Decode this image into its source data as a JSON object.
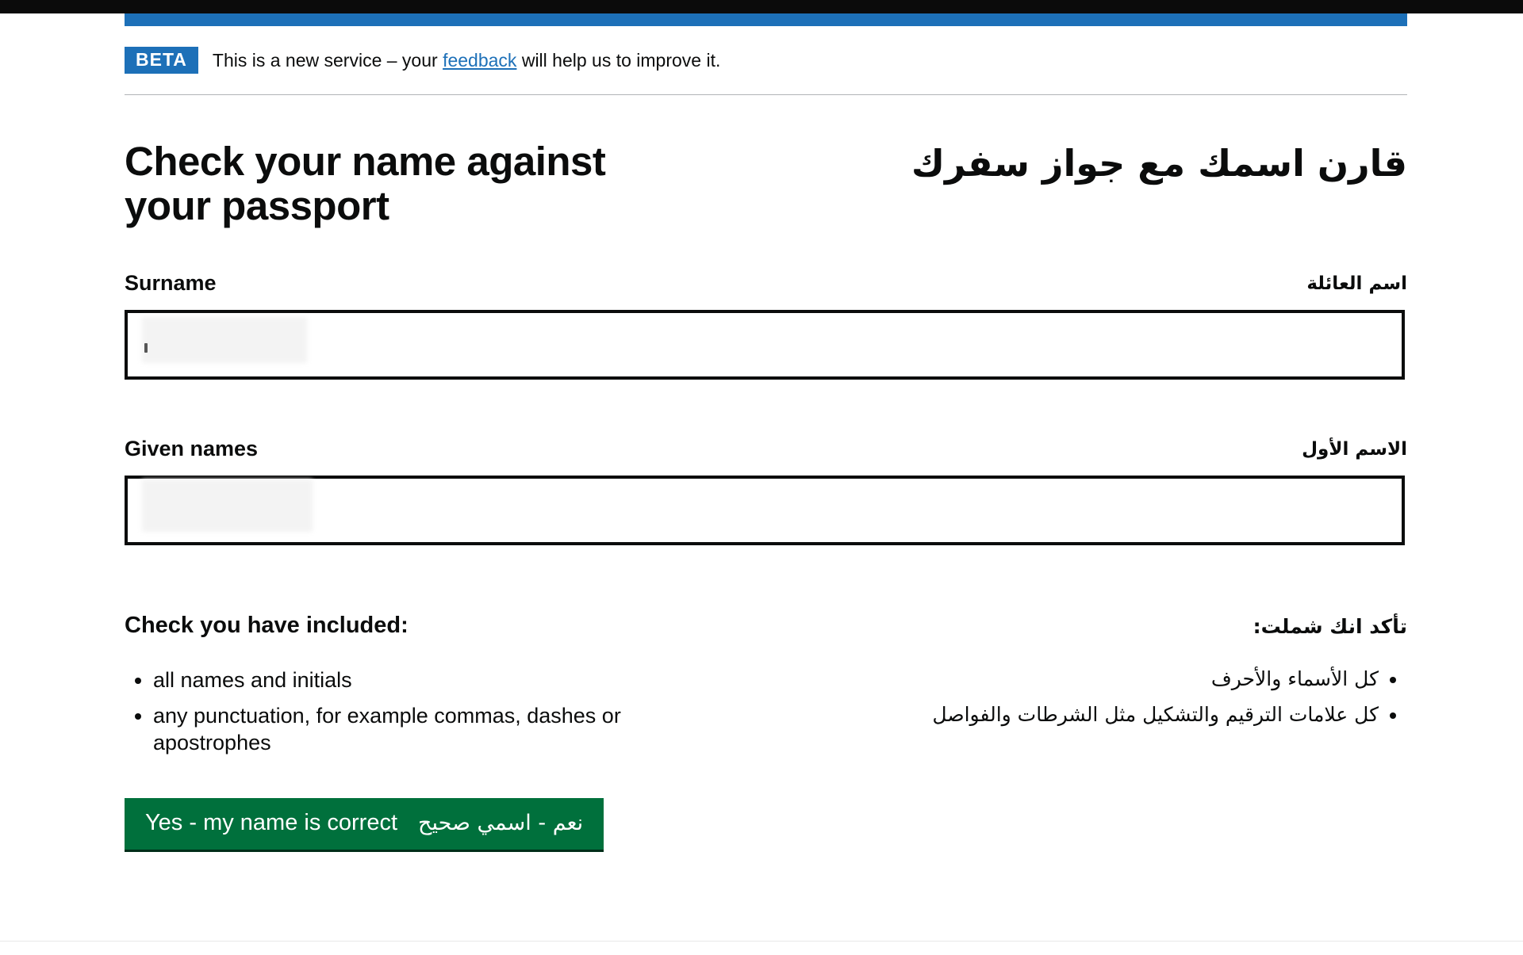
{
  "browser": {
    "chrome_bar_color": "#0b0b0b"
  },
  "brand": {
    "blue": "#1d70b8",
    "green": "#00703c",
    "text": "#0b0c0c"
  },
  "phase_banner": {
    "tag": "BETA",
    "text_before_link": "This is a new service – your ",
    "link_text": "feedback",
    "text_after_link": " will help us to improve it."
  },
  "heading": {
    "en": "Check your name against your passport",
    "ar": "قارن اسمك مع جواز سفرك"
  },
  "fields": [
    {
      "label_en": "Surname",
      "label_ar": "اسم العائلة",
      "value": "",
      "placeholder": ""
    },
    {
      "label_en": "Given names",
      "label_ar": "الاسم الأول",
      "value": "",
      "placeholder": ""
    }
  ],
  "check_section": {
    "heading_en": "Check you have included:",
    "heading_ar": "تأكد انك شملت:",
    "items_en": [
      "all names and initials",
      "any punctuation, for example commas, dashes or apostrophes"
    ],
    "items_ar": [
      "كل الأسماء والأحرف",
      "كل علامات الترقيم والتشكيل مثل الشرطات والفواصل"
    ]
  },
  "submit": {
    "label_en": "Yes - my name is correct",
    "label_ar": "نعم - اسمي صحيح"
  }
}
